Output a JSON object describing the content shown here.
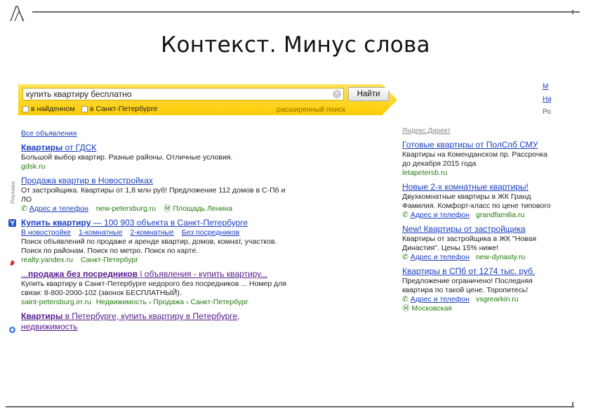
{
  "slide": {
    "title": "Контекст. Минус слова"
  },
  "search": {
    "query": "купить квартиру бесплатно",
    "button_label": "Найти",
    "checkbox_found": "в найденном",
    "checkbox_region": "в Санкт-Петербурге",
    "advanced_link": "расширенный поиск"
  },
  "left": {
    "all_ads": "Все объявления",
    "reklama_label": "Реклама",
    "results": [
      {
        "title_bold": "Квартиры",
        "title_rest": " от ГДСК",
        "text": "Большой выбор квартир. Разные районы. Отличные условия.",
        "url": "gdsk.ru"
      },
      {
        "title_bold": "Продажа квартир",
        "title_rest": " в Новостройках",
        "text": "От застройщика. Квартиры от 1,8 млн руб! Предложение 112 домов в С-Пб и ЛО",
        "address_link": "Адрес и телефон",
        "url": "new-petersburg.ru",
        "metro": "Площадь Ленина"
      },
      {
        "title_bold": "Купить квартиру",
        "title_rest": " — 100 903 объекта в Санкт-Петербурге",
        "sublinks": [
          "В новостройке",
          "1-комнатные",
          "2-комнатные",
          "Без посредников"
        ],
        "text": "Поиск объявлений по продаже и аренде квартир, домов, комнат, участков. Поиск по районам. Поиск по метро. Поиск по карте.",
        "url": "realty.yandex.ru",
        "region": "Санкт-Петербург"
      },
      {
        "title_prefix": "...",
        "title_bold": "продажа без посредников",
        "title_rest": " | объявления - купить квартиру...",
        "text": "Купить квартиру в Санкт-Петербурге недорого без посредников ... Номер для связи: 8-800-2000-102 (звонок БЕСПЛАТНЫЙ).",
        "url": "saint-petersburg.irr.ru",
        "breadcrumbs": "Недвижимость › Продажа › Санкт-Петербург"
      },
      {
        "title_bold": "Квартиры",
        "title_rest": " в Петербурге, купить квартиру в Петербурге, недвижимость"
      }
    ]
  },
  "right": {
    "direct_label": "Яндекс.Директ",
    "ads": [
      {
        "title": "Готовые квартиры от ПолСпб СМУ",
        "text": "Квартиры на Коменданском пр. Рассрочка до декабря 2015 года",
        "url": "letapetersb.ru"
      },
      {
        "title": "Новые 2-х комнатные квартиры!",
        "text": "Двухкомнатные квартиры в ЖК Гранд Фамилия. Комфорт-класс по цене типового",
        "address_link": "Адрес и телефон",
        "url": "grandfamilia.ru"
      },
      {
        "title": "New! Квартиры от застройщика",
        "text": "Квартиры от застройщика в ЖК \"Новая Династия\". Цены 15% ниже!",
        "address_link": "Адрес и телефон",
        "url": "new-dynasty.ru"
      },
      {
        "title": "Квартиры в СПб от 1274 тыс. руб.",
        "text": "Предложение ограничено! Последняя квартира по такой цене. Торопитесь!",
        "address_link": "Адрес и телефон",
        "url": "vsgrearkin.ru",
        "metro": "Московская"
      }
    ],
    "edge_links": [
      "М",
      "На",
      "Ро"
    ]
  }
}
